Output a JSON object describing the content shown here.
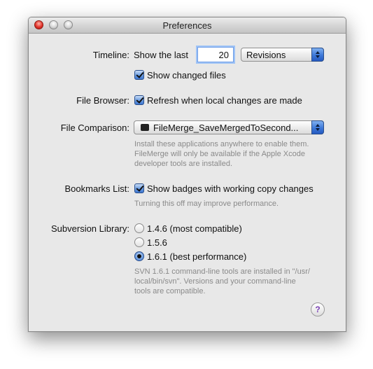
{
  "window": {
    "title": "Preferences"
  },
  "timeline": {
    "label": "Timeline:",
    "prefix": "Show the last",
    "count_value": "20",
    "unit_selected": "Revisions",
    "show_changed_files_label": "Show changed files",
    "show_changed_files_checked": true
  },
  "file_browser": {
    "label": "File Browser:",
    "refresh_label": "Refresh when local changes are made",
    "refresh_checked": true
  },
  "file_comparison": {
    "label": "File Comparison:",
    "selected": "FileMerge_SaveMergedToSecond...",
    "note_lines": [
      "Install these applications anywhere to enable them.",
      "FileMerge will only be available if the Apple Xcode",
      "developer tools are installed."
    ]
  },
  "bookmarks": {
    "label": "Bookmarks List:",
    "badges_label": "Show badges with working copy changes",
    "badges_checked": true,
    "note": "Turning this off may improve performance."
  },
  "svn": {
    "label": "Subversion Library:",
    "options": [
      {
        "label": "1.4.6 (most compatible)",
        "selected": false
      },
      {
        "label": "1.5.6",
        "selected": false
      },
      {
        "label": "1.6.1 (best performance)",
        "selected": true
      }
    ],
    "note_lines": [
      "SVN 1.6.1 command-line tools are installed in \"/usr/",
      "local/bin/svn\". Versions and your command-line",
      "tools are compatible."
    ]
  },
  "help": {
    "glyph": "?"
  },
  "colors": {
    "accent": "#3d78d8",
    "window_bg": "#e8e8e8",
    "note_text": "#8a8a8a"
  }
}
